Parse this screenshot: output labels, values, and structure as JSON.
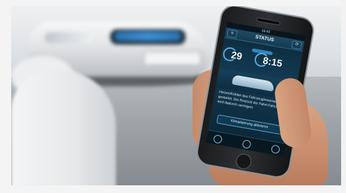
{
  "photo": {
    "subject": "hand-holding-smartphone-with-car-app",
    "background": "blurred-car-front"
  },
  "phone_app": {
    "status_time": "16:42",
    "title": "STATUS",
    "nav_left_icon": "menu-icon",
    "nav_right_icon": "refresh-icon",
    "temperature": "29",
    "time_value": "8:15",
    "message": "Heizen/Kühlen des Fahrzeuginnenraums wird gestartet. Die Restzeit der Fahrt-Fahrzeuge wird dadurch verringert.",
    "action_label": "Klimatisierung aktivieren",
    "tab_icons": [
      "wrench-icon",
      "phone-icon",
      "bars-icon"
    ]
  },
  "colors": {
    "screen_bg": "#123a52",
    "accent": "#2f86c0"
  }
}
